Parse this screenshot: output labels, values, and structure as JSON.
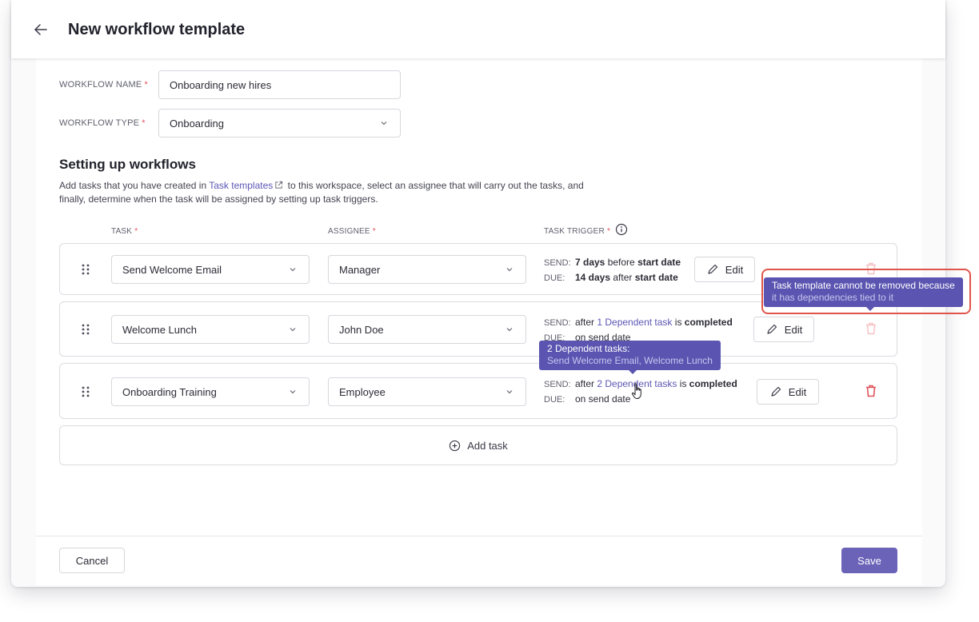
{
  "header": {
    "title": "New workflow template"
  },
  "form": {
    "workflow_name_label": "WORKFLOW NAME",
    "workflow_name_value": "Onboarding new hires",
    "workflow_type_label": "WORKFLOW TYPE",
    "workflow_type_value": "Onboarding",
    "required_mark": "*"
  },
  "section": {
    "title": "Setting up workflows",
    "desc_before": "Add tasks that you have created in ",
    "desc_link": "Task templates",
    "desc_after_line1": " to this workspace, select an assignee that will carry out the tasks, and",
    "desc_line2": "finally, determine when the task will be assigned by setting up task triggers."
  },
  "columns": {
    "task": "TASK",
    "assignee": "ASSIGNEE",
    "trigger": "TASK TRIGGER"
  },
  "labels": {
    "send": "SEND:",
    "due": "DUE:",
    "edit": "Edit"
  },
  "tasks": [
    {
      "task": "Send Welcome Email",
      "assignee": "Manager",
      "send_bold": "7 days",
      "send_mid": " before ",
      "send_end": "start date",
      "due_bold": "14 days",
      "due_mid": " after ",
      "due_end": "start date"
    },
    {
      "task": "Welcome Lunch",
      "assignee": "John Doe",
      "send_pre": "after ",
      "send_link": "1 Dependent task",
      "send_mid": " is ",
      "send_end": "completed",
      "due_text": "on send date"
    },
    {
      "task": "Onboarding Training",
      "assignee": "Employee",
      "send_pre": "after ",
      "send_link": "2 Dependent tasks",
      "send_mid": " is ",
      "send_end": "completed",
      "due_text": "on send date"
    }
  ],
  "add_task": "Add task",
  "footer": {
    "cancel": "Cancel",
    "save": "Save"
  },
  "tooltips": {
    "remove_line1": "Task template cannot be removed because",
    "remove_line2": "it has dependencies tied to it",
    "dep_line1": "2 Dependent tasks:",
    "dep_line2": "Send Welcome Email, Welcome Lunch"
  },
  "colors": {
    "accent": "#6a63b8",
    "danger": "#e0525b",
    "highlight": "#e0554a"
  },
  "icons": [
    "back-arrow-icon",
    "chevron-down-icon",
    "external-link-icon",
    "info-icon",
    "drag-handle-icon",
    "pencil-icon",
    "trash-icon",
    "plus-circle-icon",
    "hand-cursor-icon"
  ]
}
